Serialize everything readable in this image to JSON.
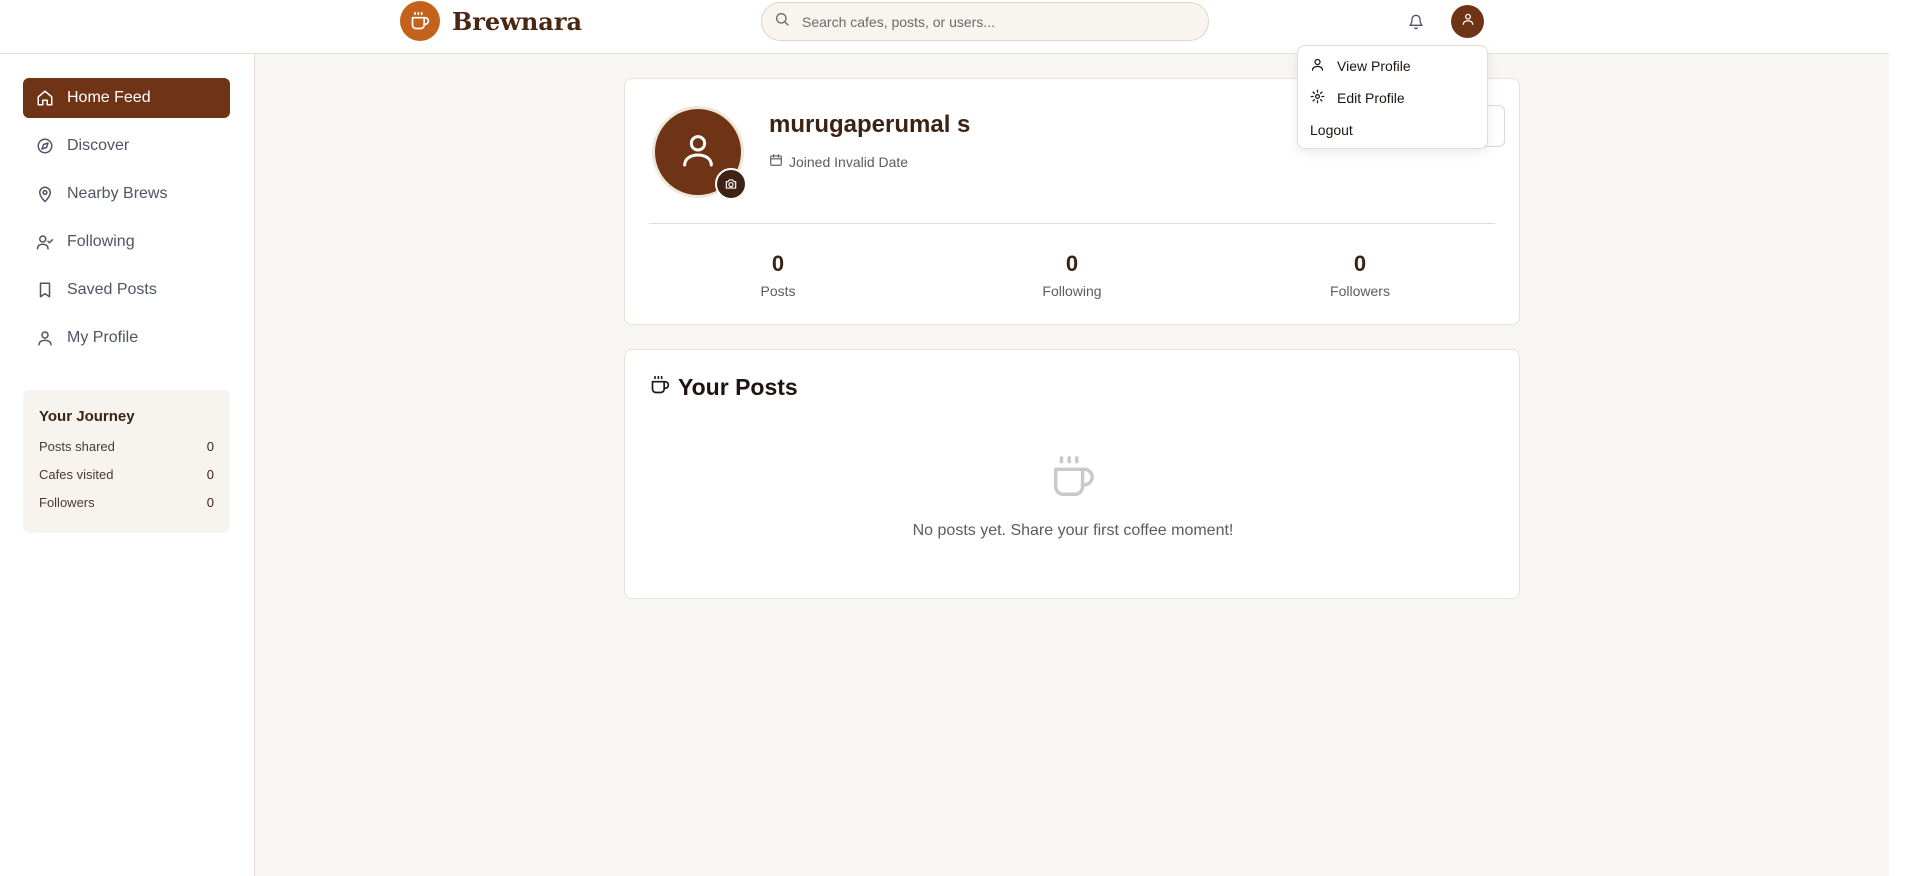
{
  "app": {
    "name": "Brewnara",
    "brand_color": "#6f3416",
    "accent_color": "#c4621b"
  },
  "search": {
    "placeholder": "Search cafes, posts, or users...",
    "icon": "search-icon"
  },
  "header": {
    "notification_icon": "bell-icon",
    "avatar_icon": "user-icon"
  },
  "sidebar": {
    "items": [
      {
        "label": "Home Feed",
        "icon": "home-icon",
        "active": true
      },
      {
        "label": "Discover",
        "icon": "compass-icon"
      },
      {
        "label": "Nearby Brews",
        "icon": "map-pin-icon"
      },
      {
        "label": "Following",
        "icon": "user-check-icon"
      },
      {
        "label": "Saved Posts",
        "icon": "bookmark-icon"
      },
      {
        "label": "My Profile",
        "icon": "user-icon"
      }
    ],
    "journey": {
      "title": "Your Journey",
      "rows": [
        {
          "label": "Posts shared",
          "value": "0"
        },
        {
          "label": "Cafes visited",
          "value": "0"
        },
        {
          "label": "Followers",
          "value": "0"
        }
      ]
    }
  },
  "profile": {
    "username": "murugaperumal s",
    "joined": "Joined Invalid Date",
    "stats": [
      {
        "value": "0",
        "label": "Posts"
      },
      {
        "value": "0",
        "label": "Following"
      },
      {
        "value": "0",
        "label": "Followers"
      }
    ]
  },
  "posts": {
    "title": "Your Posts",
    "empty_text": "No posts yet. Share your first coffee moment!"
  },
  "dropdown": {
    "items": [
      {
        "label": "View Profile",
        "icon": "user-icon"
      },
      {
        "label": "Edit Profile",
        "icon": "gear-icon"
      },
      {
        "label": "Logout"
      }
    ]
  }
}
